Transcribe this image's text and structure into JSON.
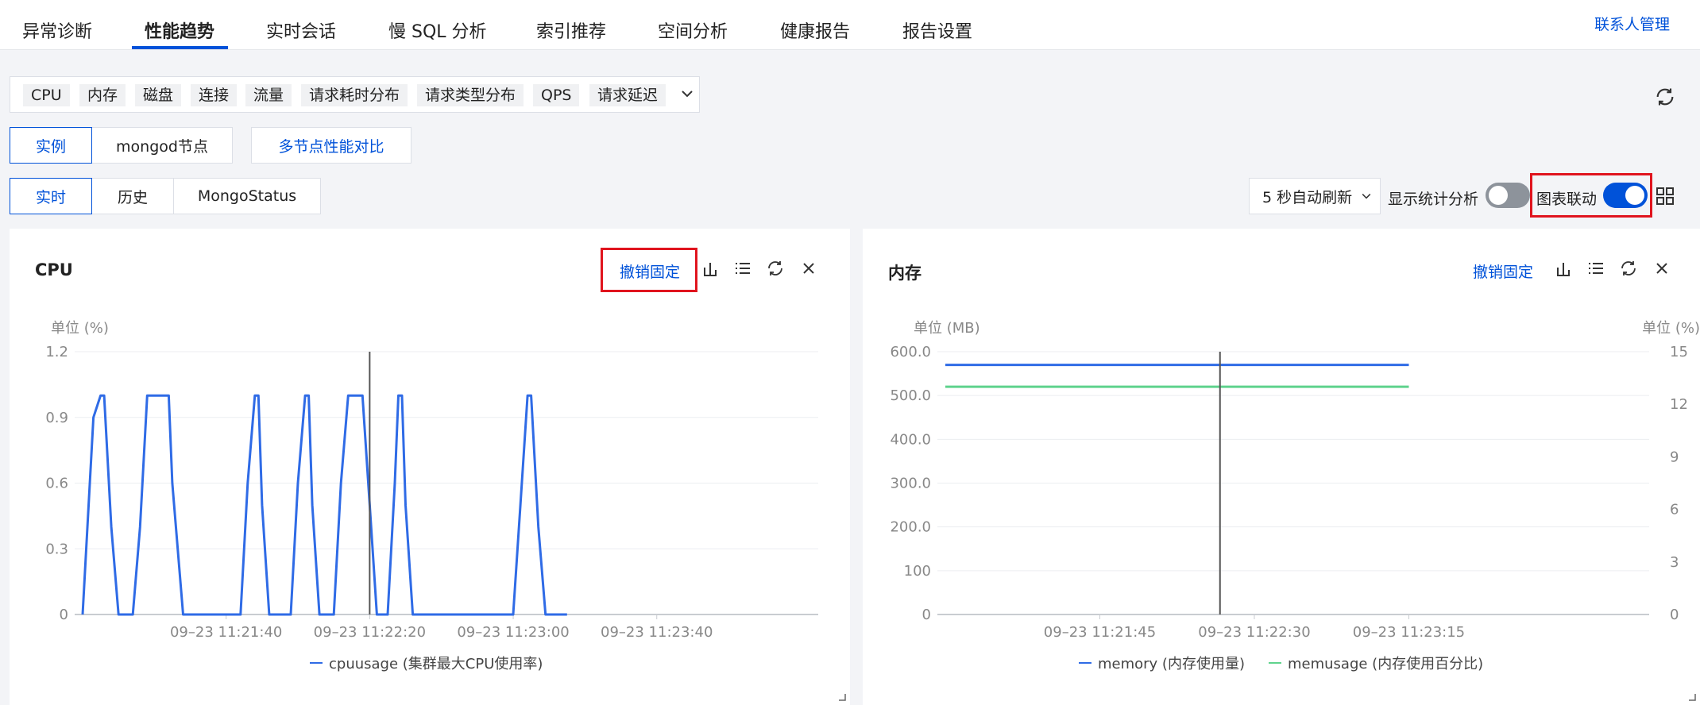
{
  "nav": {
    "tabs": [
      "异常诊断",
      "性能趋势",
      "实时会话",
      "慢 SQL 分析",
      "索引推荐",
      "空间分析",
      "健康报告",
      "报告设置"
    ],
    "active": "性能趋势",
    "contact": "联系人管理"
  },
  "metrics": [
    "CPU",
    "内存",
    "磁盘",
    "连接",
    "流量",
    "请求耗时分布",
    "请求类型分布",
    "QPS",
    "请求延迟"
  ],
  "scope": {
    "instance": "实例",
    "node": "mongod节点",
    "compare": "多节点性能对比"
  },
  "mode": {
    "realtime": "实时",
    "history": "历史",
    "mongostatus": "MongoStatus"
  },
  "controls": {
    "auto_refresh": "5 秒自动刷新",
    "show_stats": "显示统计分析",
    "show_stats_on": false,
    "chart_link": "图表联动",
    "chart_link_on": true
  },
  "colors": {
    "accent": "#0052d9",
    "memory": "#2f6be6",
    "memusage": "#5fd38d",
    "highlight": "#e0141e"
  },
  "icons": [
    "refresh-icon",
    "chevron-down-icon",
    "grid-icon",
    "bar-chart-icon",
    "list-icon",
    "close-icon",
    "resize-icon"
  ],
  "panels": {
    "cpu": {
      "title": "CPU",
      "unpin": "撤销固定",
      "unit_left": "单位 (%)"
    },
    "mem": {
      "title": "内存",
      "unpin": "撤销固定",
      "unit_left": "单位 (MB)",
      "unit_right": "单位 (%)"
    }
  },
  "chart_data": [
    {
      "type": "line",
      "title": "CPU",
      "ylabel": "单位 (%)",
      "ylim": [
        0,
        1.2
      ],
      "yticks": [
        "0",
        "0.3",
        "0.6",
        "0.9",
        "1.2"
      ],
      "xticks": [
        "09–23 11:21:40",
        "09–23 11:22:20",
        "09–23 11:23:00",
        "09–23 11:23:40"
      ],
      "grid": true,
      "legend_position": "bottom",
      "series": [
        {
          "name": "cpuusage (集群最大CPU使用率)",
          "color": "#2f6be6",
          "points": [
            [
              0,
              0
            ],
            [
              3,
              0.9
            ],
            [
              5,
              1
            ],
            [
              6,
              1
            ],
            [
              8,
              0.4
            ],
            [
              10,
              0
            ],
            [
              14,
              0
            ],
            [
              16,
              0.4
            ],
            [
              18,
              1
            ],
            [
              24,
              1
            ],
            [
              25,
              0.6
            ],
            [
              28,
              0
            ],
            [
              44,
              0
            ],
            [
              46,
              0.6
            ],
            [
              48,
              1
            ],
            [
              49,
              1
            ],
            [
              50,
              0.5
            ],
            [
              52,
              0
            ],
            [
              58,
              0
            ],
            [
              60,
              0.6
            ],
            [
              62,
              1
            ],
            [
              63,
              1
            ],
            [
              64,
              0.5
            ],
            [
              66,
              0
            ],
            [
              70,
              0
            ],
            [
              72,
              0.6
            ],
            [
              74,
              1
            ],
            [
              78,
              1
            ],
            [
              80,
              0.5
            ],
            [
              82,
              0
            ],
            [
              85,
              0
            ],
            [
              87,
              0.6
            ],
            [
              88,
              1
            ],
            [
              89,
              1
            ],
            [
              90,
              0.5
            ],
            [
              92,
              0
            ],
            [
              120,
              0
            ],
            [
              122,
              0.5
            ],
            [
              124,
              1
            ],
            [
              125,
              1
            ],
            [
              127,
              0.4
            ],
            [
              129,
              0
            ],
            [
              135,
              0
            ]
          ]
        }
      ],
      "crosshair_x": 80,
      "x_domain": [
        0,
        205
      ],
      "x_tick_values": [
        40,
        80,
        120,
        160
      ]
    },
    {
      "type": "line",
      "title": "内存",
      "ylabel": "单位 (MB)",
      "ylabel_right": "单位 (%)",
      "ylim": [
        0,
        600
      ],
      "ylim_right": [
        0,
        15
      ],
      "yticks": [
        "0",
        "100",
        "200.0",
        "300.0",
        "400.0",
        "500.0",
        "600.0"
      ],
      "yticks_right": [
        "0",
        "3",
        "6",
        "9",
        "12",
        "15"
      ],
      "xticks": [
        "09–23 11:21:45",
        "09–23 11:22:30",
        "09–23 11:23:15"
      ],
      "grid": true,
      "legend_position": "bottom",
      "series": [
        {
          "name": "memory (内存使用量)",
          "color": "#2f6be6",
          "axis": "left",
          "points": [
            [
              0,
              570
            ],
            [
              135,
              570
            ]
          ]
        },
        {
          "name": "memusage (内存使用百分比)",
          "color": "#5fd38d",
          "axis": "right",
          "points": [
            [
              0,
              13
            ],
            [
              135,
              13
            ]
          ]
        }
      ],
      "crosshair_x": 80,
      "x_domain": [
        0,
        205
      ],
      "x_tick_values": [
        45,
        90,
        135
      ]
    }
  ]
}
